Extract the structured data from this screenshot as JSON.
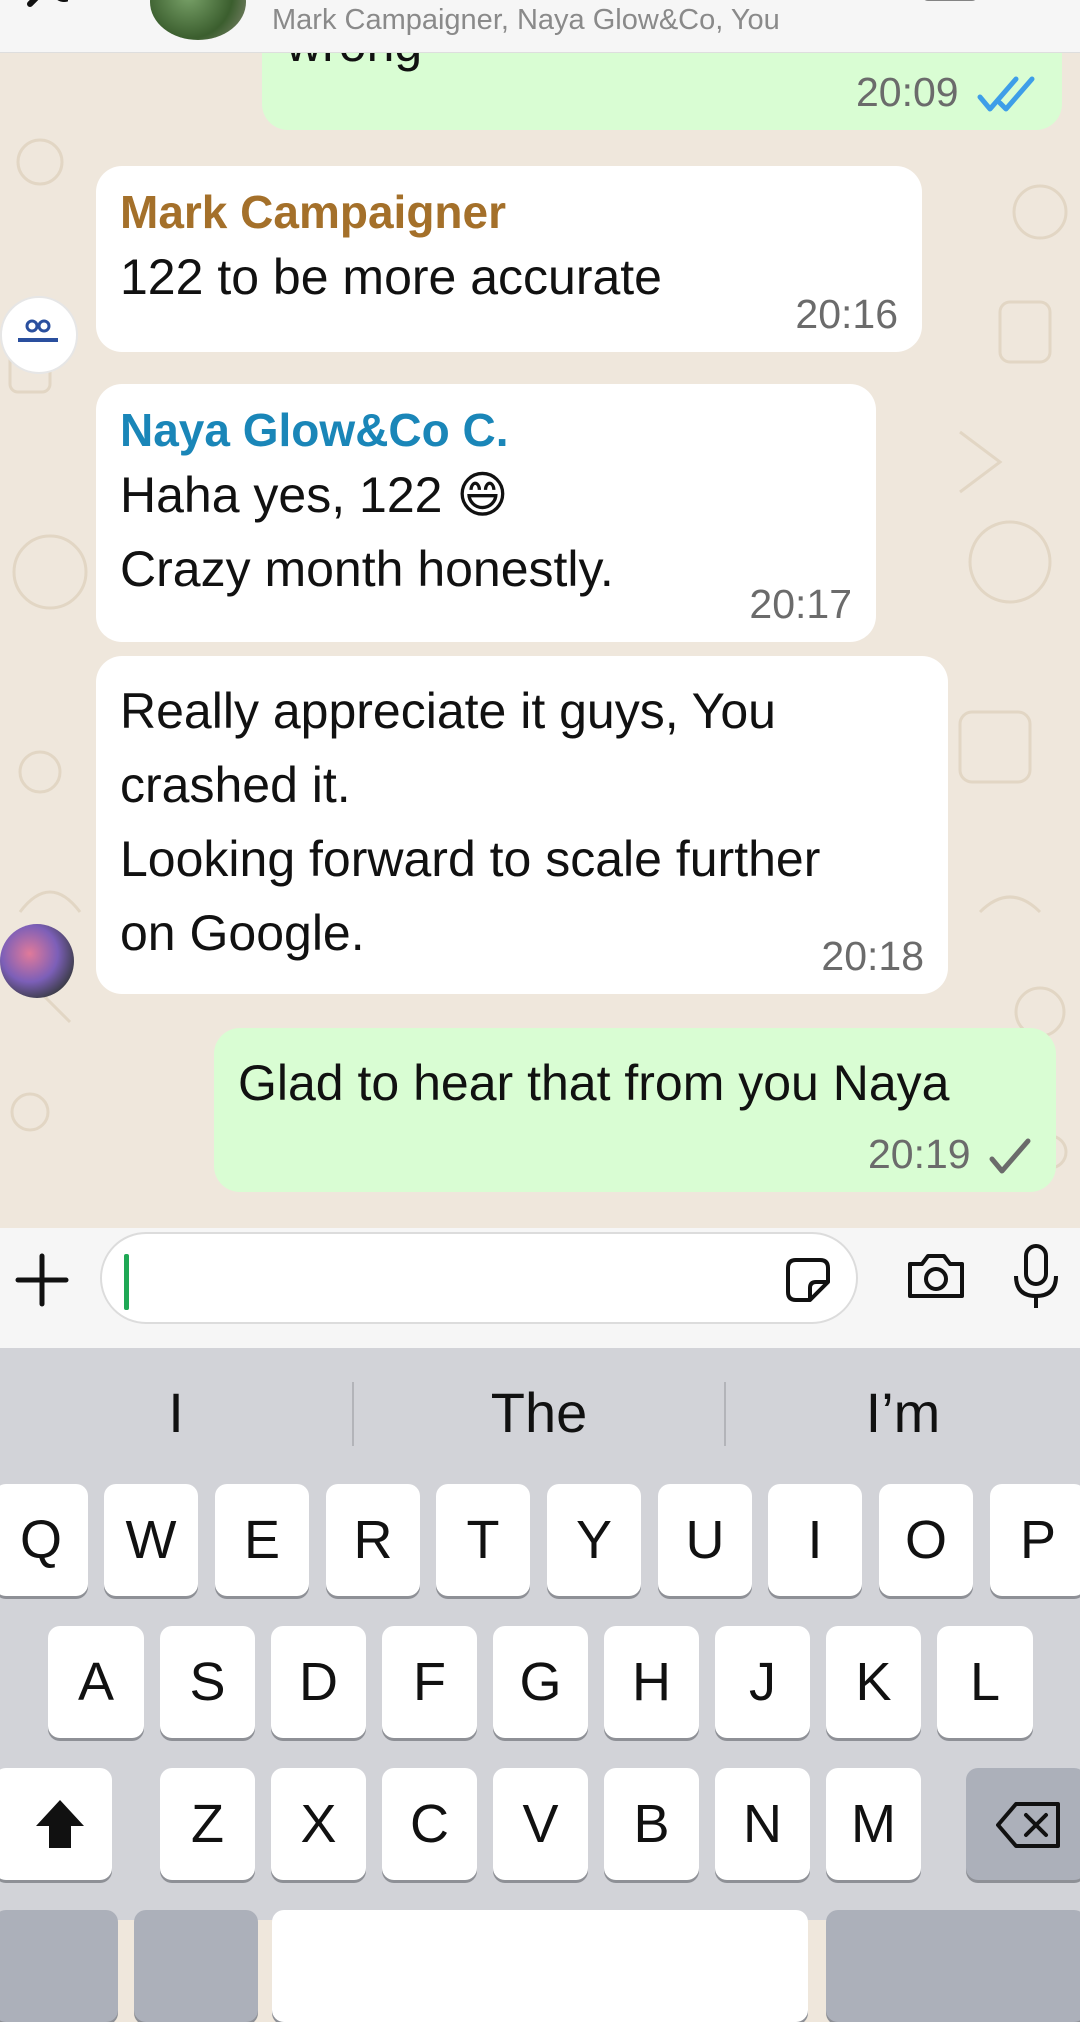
{
  "header": {
    "subtitle": "Mark Campaigner, Naya Glow&Co, You"
  },
  "messages": [
    {
      "id": "m1",
      "direction": "out",
      "text": "wrong",
      "time": "20:09",
      "status": "read"
    },
    {
      "id": "m2",
      "direction": "in",
      "sender": "Mark Campaigner",
      "sender_color": "#a4702a",
      "text": "122 to be more accurate",
      "time": "20:16"
    },
    {
      "id": "m3",
      "direction": "in",
      "sender": "Naya Glow&Co C.",
      "sender_color": "#1a86b8",
      "text": "Haha yes, 122 😄\nCrazy month honestly.",
      "time": "20:17"
    },
    {
      "id": "m4",
      "direction": "in",
      "text": "Really appreciate it guys, You\ncrashed it.\nLooking forward to scale further\non Google.",
      "time": "20:18"
    },
    {
      "id": "m5",
      "direction": "out",
      "text": "Glad to hear that from you Naya",
      "time": "20:19",
      "status": "sent"
    }
  ],
  "avatars": {
    "mark_logo_text": "HENTEN"
  },
  "input": {
    "value": "",
    "placeholder": ""
  },
  "keyboard": {
    "suggestions": [
      "I",
      "The",
      "I’m"
    ],
    "row1": [
      "Q",
      "W",
      "E",
      "R",
      "T",
      "Y",
      "U",
      "I",
      "O",
      "P"
    ],
    "row2": [
      "A",
      "S",
      "D",
      "F",
      "G",
      "H",
      "J",
      "K",
      "L"
    ],
    "row3": [
      "Z",
      "X",
      "C",
      "V",
      "B",
      "N",
      "M"
    ]
  },
  "colors": {
    "outgoing_bubble": "#d9fdd3",
    "incoming_bubble": "#ffffff",
    "read_tick": "#3e9ee8",
    "cursor": "#1fa855"
  }
}
